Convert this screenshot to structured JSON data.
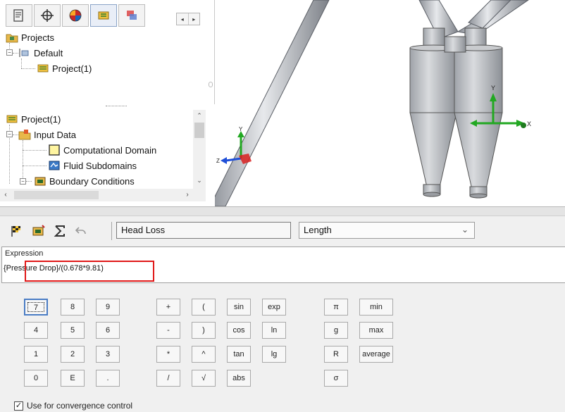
{
  "tabs": [
    {
      "name": "feature-manager-tab",
      "icon": "feature-manager-icon"
    },
    {
      "name": "property-manager-tab",
      "icon": "crosshair-icon"
    },
    {
      "name": "appearance-tab",
      "icon": "appearance-sphere-icon"
    },
    {
      "name": "flow-simulation-tab",
      "icon": "flow-simulation-icon"
    },
    {
      "name": "display-manager-tab",
      "icon": "display-manager-icon"
    }
  ],
  "project_tree": {
    "root": "Projects",
    "default": "Default",
    "project": "Project(1)"
  },
  "feature_tree": {
    "root": "Project(1)",
    "input_data": "Input Data",
    "computational_domain": "Computational Domain",
    "fluid_subdomains": "Fluid Subdomains",
    "boundary_conditions": "Boundary Conditions"
  },
  "viewport": {
    "axis_y": "Y",
    "axis_z": "Z",
    "triad_y": "Y",
    "triad_x": "X"
  },
  "toolbar": {
    "name_value": "Head Loss",
    "unit_value": "Length"
  },
  "expression": {
    "label": "Expression",
    "value": "{Pressure Drop}/(0.678*9.81)"
  },
  "keypad": {
    "keys": [
      "7",
      "8",
      "9",
      "4",
      "5",
      "6",
      "1",
      "2",
      "3",
      "0",
      "E",
      "."
    ],
    "ops": [
      "+",
      "(",
      "-",
      ")",
      "*",
      "^",
      "/",
      "√"
    ],
    "funcs": [
      "sin",
      "exp",
      "cos",
      "ln",
      "tan",
      "lg",
      "abs"
    ],
    "consts": [
      "π",
      "g",
      "R",
      "σ"
    ],
    "aggs": [
      "min",
      "max",
      "average"
    ]
  },
  "convergence_label": "Use for convergence control",
  "colors": {
    "highlight": "#e01818",
    "axis_y": "#22a822",
    "axis_z": "#1f4fd8",
    "axis_x": "#d82020"
  }
}
